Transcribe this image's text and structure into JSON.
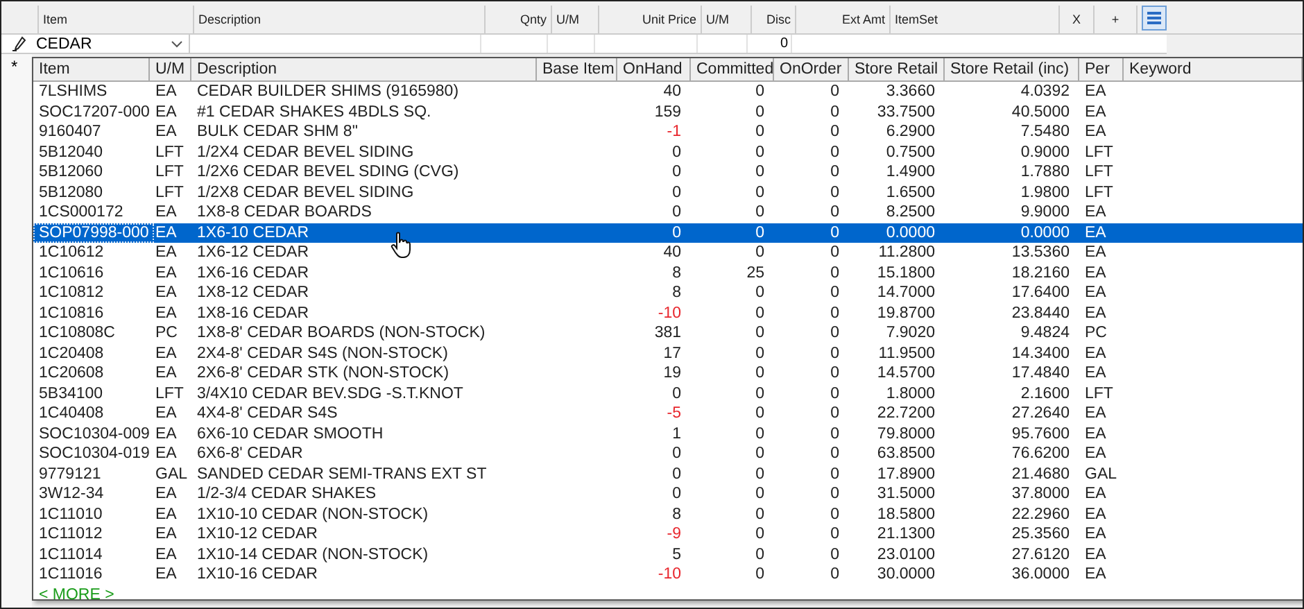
{
  "order_grid": {
    "columns": [
      "Item",
      "Description",
      "Qnty",
      "U/M",
      "Unit Price",
      "U/M",
      "Disc",
      "Ext Amt",
      "ItemSet",
      "X",
      "+"
    ],
    "edit_row": {
      "item_value": "CEDAR",
      "disc": "0"
    }
  },
  "dropdown": {
    "new_row_marker": "*",
    "columns": [
      "Item",
      "U/M",
      "Description",
      "Base Item",
      "OnHand",
      "Committed",
      "OnOrder",
      "Store Retail",
      "Store Retail (inc)",
      "Per",
      "Keyword"
    ],
    "rows": [
      {
        "item": "7LSHIMS",
        "um": "EA",
        "description": "CEDAR BUILDER SHIMS  (9165980)",
        "onhand": "40",
        "low_stock": false,
        "committed": "0",
        "onorder": "0",
        "retail": "3.3660",
        "retail_inc": "4.0392",
        "per": "EA",
        "selected": false
      },
      {
        "item": "SOC17207-000",
        "um": "EA",
        "description": "#1 CEDAR SHAKES 4BDLS SQ.",
        "onhand": "159",
        "low_stock": false,
        "committed": "0",
        "onorder": "0",
        "retail": "33.7500",
        "retail_inc": "40.5000",
        "per": "EA",
        "selected": false
      },
      {
        "item": "9160407",
        "um": "EA",
        "description": "BULK CEDAR SHM 8\"",
        "onhand": "-1",
        "low_stock": true,
        "committed": "0",
        "onorder": "0",
        "retail": "6.2900",
        "retail_inc": "7.5480",
        "per": "EA",
        "selected": false
      },
      {
        "item": "5B12040",
        "um": "LFT",
        "description": "1/2X4 CEDAR BEVEL SIDING",
        "onhand": "0",
        "low_stock": false,
        "committed": "0",
        "onorder": "0",
        "retail": "0.7500",
        "retail_inc": "0.9000",
        "per": "LFT",
        "selected": false
      },
      {
        "item": "5B12060",
        "um": "LFT",
        "description": "1/2X6 CEDAR BEVEL SDING (CVG)",
        "onhand": "0",
        "low_stock": false,
        "committed": "0",
        "onorder": "0",
        "retail": "1.4900",
        "retail_inc": "1.7880",
        "per": "LFT",
        "selected": false
      },
      {
        "item": "5B12080",
        "um": "LFT",
        "description": "1/2X8 CEDAR BEVEL SIDING",
        "onhand": "0",
        "low_stock": false,
        "committed": "0",
        "onorder": "0",
        "retail": "1.6500",
        "retail_inc": "1.9800",
        "per": "LFT",
        "selected": false
      },
      {
        "item": "1CS000172",
        "um": "EA",
        "description": "1X8-8 CEDAR BOARDS",
        "onhand": "0",
        "low_stock": false,
        "committed": "0",
        "onorder": "0",
        "retail": "8.2500",
        "retail_inc": "9.9000",
        "per": "EA",
        "selected": false
      },
      {
        "item": "SOP07998-000",
        "um": "EA",
        "description": "1X6-10 CEDAR",
        "onhand": "0",
        "low_stock": false,
        "committed": "0",
        "onorder": "0",
        "retail": "0.0000",
        "retail_inc": "0.0000",
        "per": "EA",
        "selected": true
      },
      {
        "item": "1C10612",
        "um": "EA",
        "description": "1X6-12 CEDAR",
        "onhand": "40",
        "low_stock": false,
        "committed": "0",
        "onorder": "0",
        "retail": "11.2800",
        "retail_inc": "13.5360",
        "per": "EA",
        "selected": false
      },
      {
        "item": "1C10616",
        "um": "EA",
        "description": "1X6-16 CEDAR",
        "onhand": "8",
        "low_stock": false,
        "committed": "25",
        "onorder": "0",
        "retail": "15.1800",
        "retail_inc": "18.2160",
        "per": "EA",
        "selected": false
      },
      {
        "item": "1C10812",
        "um": "EA",
        "description": "1X8-12 CEDAR",
        "onhand": "8",
        "low_stock": false,
        "committed": "0",
        "onorder": "0",
        "retail": "14.7000",
        "retail_inc": "17.6400",
        "per": "EA",
        "selected": false
      },
      {
        "item": "1C10816",
        "um": "EA",
        "description": "1X8-16 CEDAR",
        "onhand": "-10",
        "low_stock": true,
        "committed": "0",
        "onorder": "0",
        "retail": "19.8700",
        "retail_inc": "23.8440",
        "per": "EA",
        "selected": false
      },
      {
        "item": "1C10808C",
        "um": "PC",
        "description": "1X8-8' CEDAR BOARDS (NON-STOCK)",
        "onhand": "381",
        "low_stock": false,
        "committed": "0",
        "onorder": "0",
        "retail": "7.9020",
        "retail_inc": "9.4824",
        "per": "PC",
        "selected": false
      },
      {
        "item": "1C20408",
        "um": "EA",
        "description": "2X4-8' CEDAR S4S  (NON-STOCK)",
        "onhand": "17",
        "low_stock": false,
        "committed": "0",
        "onorder": "0",
        "retail": "11.9500",
        "retail_inc": "14.3400",
        "per": "EA",
        "selected": false
      },
      {
        "item": "1C20608",
        "um": "EA",
        "description": "2X6-8' CEDAR STK (NON-STOCK)",
        "onhand": "19",
        "low_stock": false,
        "committed": "0",
        "onorder": "0",
        "retail": "14.5700",
        "retail_inc": "17.4840",
        "per": "EA",
        "selected": false
      },
      {
        "item": "5B34100",
        "um": "LFT",
        "description": "3/4X10 CEDAR BEV.SDG -S.T.KNOT",
        "onhand": "0",
        "low_stock": false,
        "committed": "0",
        "onorder": "0",
        "retail": "1.8000",
        "retail_inc": "2.1600",
        "per": "LFT",
        "selected": false
      },
      {
        "item": "1C40408",
        "um": "EA",
        "description": "4X4-8' CEDAR S4S",
        "onhand": "-5",
        "low_stock": true,
        "committed": "0",
        "onorder": "0",
        "retail": "22.7200",
        "retail_inc": "27.2640",
        "per": "EA",
        "selected": false
      },
      {
        "item": "SOC10304-009",
        "um": "EA",
        "description": "6X6-10 CEDAR SMOOTH",
        "onhand": "1",
        "low_stock": false,
        "committed": "0",
        "onorder": "0",
        "retail": "79.8000",
        "retail_inc": "95.7600",
        "per": "EA",
        "selected": false
      },
      {
        "item": "SOC10304-019",
        "um": "EA",
        "description": "6X6-8' CEDAR",
        "onhand": "0",
        "low_stock": false,
        "committed": "0",
        "onorder": "0",
        "retail": "63.8500",
        "retail_inc": "76.6200",
        "per": "EA",
        "selected": false
      },
      {
        "item": "9779121",
        "um": "GAL",
        "description": "SANDED CEDAR SEMI-TRANS EXT ST",
        "onhand": "0",
        "low_stock": false,
        "committed": "0",
        "onorder": "0",
        "retail": "17.8900",
        "retail_inc": "21.4680",
        "per": "GAL",
        "selected": false
      },
      {
        "item": "3W12-34",
        "um": "EA",
        "description": "1/2-3/4 CEDAR SHAKES",
        "onhand": "0",
        "low_stock": false,
        "committed": "0",
        "onorder": "0",
        "retail": "31.5000",
        "retail_inc": "37.8000",
        "per": "EA",
        "selected": false
      },
      {
        "item": "1C11010",
        "um": "EA",
        "description": "1X10-10 CEDAR (NON-STOCK)",
        "onhand": "8",
        "low_stock": false,
        "committed": "0",
        "onorder": "0",
        "retail": "18.5800",
        "retail_inc": "22.2960",
        "per": "EA",
        "selected": false
      },
      {
        "item": "1C11012",
        "um": "EA",
        "description": "1X10-12 CEDAR",
        "onhand": "-9",
        "low_stock": true,
        "committed": "0",
        "onorder": "0",
        "retail": "21.1300",
        "retail_inc": "25.3560",
        "per": "EA",
        "selected": false
      },
      {
        "item": "1C11014",
        "um": "EA",
        "description": "1X10-14 CEDAR (NON-STOCK)",
        "onhand": "5",
        "low_stock": false,
        "committed": "0",
        "onorder": "0",
        "retail": "23.0100",
        "retail_inc": "27.6120",
        "per": "EA",
        "selected": false
      },
      {
        "item": "1C11016",
        "um": "EA",
        "description": "1X10-16 CEDAR",
        "onhand": "-10",
        "low_stock": true,
        "committed": "0",
        "onorder": "0",
        "retail": "30.0000",
        "retail_inc": "36.0000",
        "per": "EA",
        "selected": false
      }
    ],
    "more_link": "< MORE >"
  }
}
